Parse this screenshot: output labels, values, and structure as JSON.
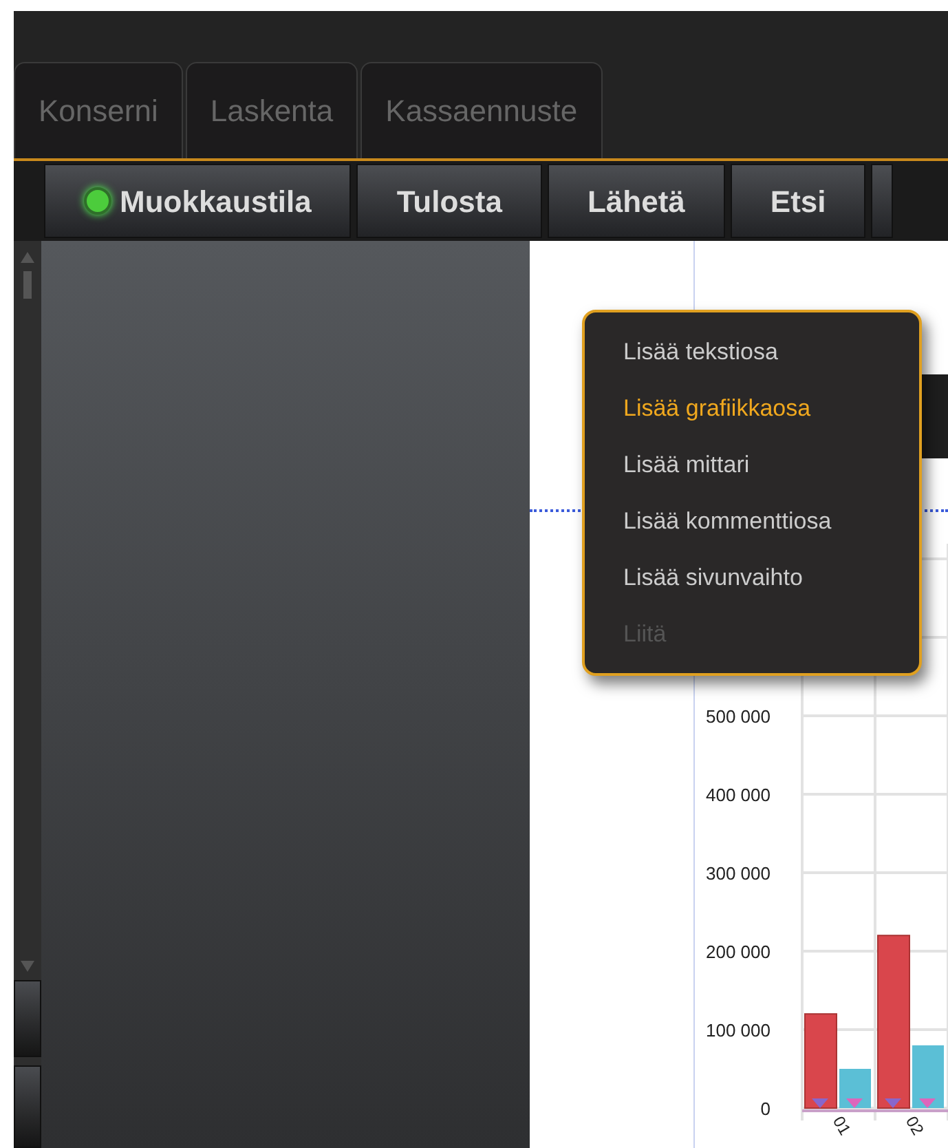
{
  "tabs": [
    {
      "label": "Konserni",
      "selected": false
    },
    {
      "label": "Laskenta",
      "selected": false
    },
    {
      "label": "Kassaennuste",
      "selected": false
    }
  ],
  "toolbar": {
    "buttons": [
      {
        "label": "Muokkaustila",
        "kind": "led",
        "on": true
      },
      {
        "label": "Tulosta",
        "kind": "plain"
      },
      {
        "label": "Lähetä",
        "kind": "plain"
      },
      {
        "label": "Etsi",
        "kind": "plain"
      }
    ]
  },
  "report": {
    "chart_data": {
      "type": "bar",
      "grid": true,
      "categories": [
        "01",
        "02"
      ],
      "series": [
        {
          "color": "#d9464c",
          "values": [
            120000,
            220000
          ]
        },
        {
          "color": "#5bbfd6",
          "values": [
            50000,
            80000
          ]
        }
      ],
      "ylim": [
        0,
        700000
      ],
      "yticks": [
        {
          "value": 0,
          "label": "0"
        },
        {
          "value": 100000,
          "label": "100 000"
        },
        {
          "value": 200000,
          "label": "200 000"
        },
        {
          "value": 300000,
          "label": "300 000"
        },
        {
          "value": 400000,
          "label": "400 000"
        },
        {
          "value": 500000,
          "label": "500 000"
        }
      ]
    }
  },
  "context_menu": {
    "items": [
      {
        "label": "Lisää tekstiosa",
        "selected": false,
        "disabled": false
      },
      {
        "label": "Lisää grafiikkaosa",
        "selected": true,
        "disabled": false
      },
      {
        "label": "Lisää mittari",
        "selected": false,
        "disabled": false
      },
      {
        "label": "Lisää kommenttiosa",
        "selected": false,
        "disabled": false
      },
      {
        "label": "Lisää sivunvaihto",
        "selected": false,
        "disabled": false
      },
      {
        "label": "Liitä",
        "selected": false,
        "disabled": true
      }
    ]
  }
}
